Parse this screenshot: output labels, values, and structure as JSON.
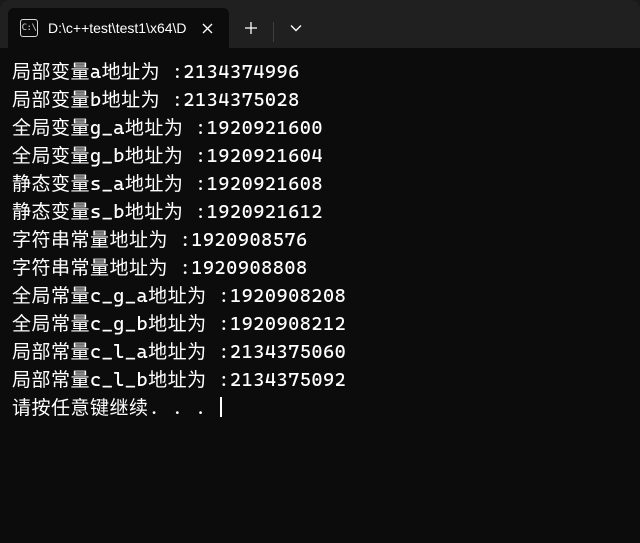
{
  "tab": {
    "icon_text": "C:\\",
    "title": "D:\\c++test\\test1\\x64\\D"
  },
  "output": {
    "lines": [
      {
        "label": "局部变量a地址为 :",
        "value": "2134374996"
      },
      {
        "label": "局部变量b地址为 :",
        "value": "2134375028"
      },
      {
        "label": "全局变量g_a地址为 :",
        "value": "1920921600"
      },
      {
        "label": "全局变量g_b地址为 :",
        "value": "1920921604"
      },
      {
        "label": "静态变量s_a地址为 :",
        "value": "1920921608"
      },
      {
        "label": "静态变量s_b地址为 :",
        "value": "1920921612"
      },
      {
        "label": "字符串常量地址为 :",
        "value": "1920908576"
      },
      {
        "label": "字符串常量地址为 :",
        "value": "1920908808"
      },
      {
        "label": "全局常量c_g_a地址为 :",
        "value": "1920908208"
      },
      {
        "label": "全局常量c_g_b地址为 :",
        "value": "1920908212"
      },
      {
        "label": "局部常量c_l_a地址为 :",
        "value": "2134375060"
      },
      {
        "label": "局部常量c_l_b地址为 :",
        "value": "2134375092"
      }
    ],
    "prompt": "请按任意键继续. . . "
  }
}
